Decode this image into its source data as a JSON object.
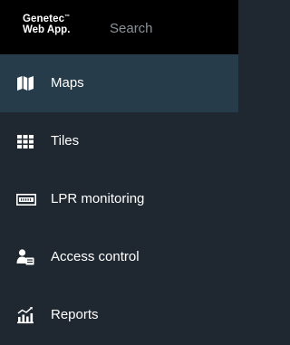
{
  "header": {
    "logo_line1": "Genetec",
    "logo_tm": "™",
    "logo_line2": "Web App.",
    "search_placeholder": "Search"
  },
  "sidebar": {
    "items": [
      {
        "label": "Maps",
        "icon": "map-icon",
        "active": true
      },
      {
        "label": "Tiles",
        "icon": "grid-icon",
        "active": false
      },
      {
        "label": "LPR monitoring",
        "icon": "license-plate-icon",
        "active": false
      },
      {
        "label": "Access control",
        "icon": "user-badge-icon",
        "active": false
      },
      {
        "label": "Reports",
        "icon": "report-chart-icon",
        "active": false
      }
    ]
  },
  "colors": {
    "topbar_bg": "#000000",
    "sidebar_bg": "#1f2830",
    "active_bg": "#263c4a",
    "text": "#ffffff"
  }
}
